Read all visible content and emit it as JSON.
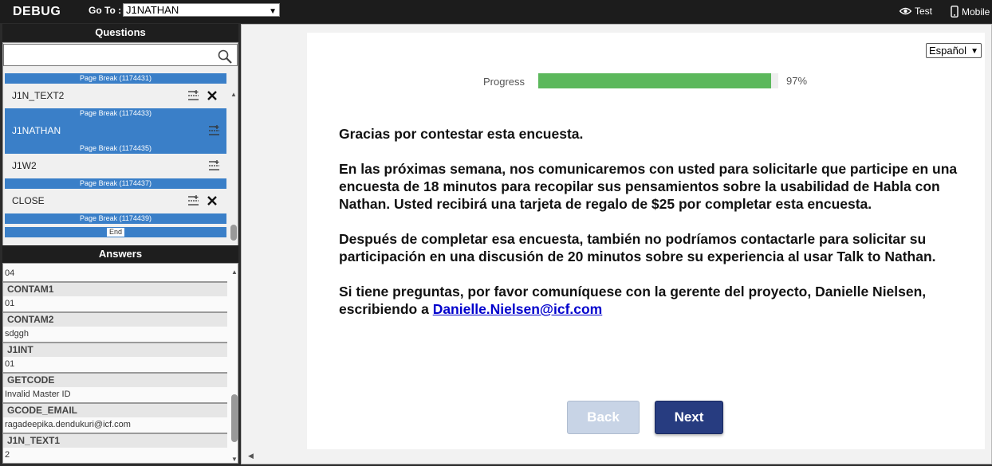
{
  "topbar": {
    "brand": "DEBUG",
    "goto_label": "Go To :",
    "goto_value": "J1NATHAN",
    "test_label": "Test",
    "mobile_label": "Mobile"
  },
  "questions": {
    "header": "Questions",
    "search_value": "",
    "items": [
      {
        "break": "Page Break (1174431)",
        "name": "J1N_TEXT2",
        "selected": false,
        "deletable": true
      },
      {
        "break": "Page Break (1174433)",
        "name": "J1NATHAN",
        "selected": true,
        "deletable": false
      },
      {
        "break": "Page Break (1174435)",
        "name": "J1W2",
        "selected": false,
        "deletable": false
      },
      {
        "break": "Page Break (1174437)",
        "name": "CLOSE",
        "selected": false,
        "deletable": true
      }
    ],
    "last_break": "Page Break (1174439)",
    "end_label": "End"
  },
  "answers": {
    "header": "Answers",
    "first_value": "04",
    "rows": [
      {
        "name": "CONTAM1",
        "value": "01"
      },
      {
        "name": "CONTAM2",
        "value": "sdggh"
      },
      {
        "name": "J1INT",
        "value": "01"
      },
      {
        "name": "GETCODE",
        "value": "Invalid Master ID"
      },
      {
        "name": "GCODE_EMAIL",
        "value": "ragadeepika.dendukuri@icf.com"
      },
      {
        "name": "J1N_TEXT1",
        "value": "2"
      }
    ]
  },
  "survey": {
    "language": "Español",
    "progress_label": "Progress",
    "progress_percent": 97,
    "progress_text": "97%",
    "progress_color": "#5cb85c",
    "paragraph1": "Gracias por contestar esta encuesta.",
    "paragraph2": "En las próximas semana, nos comunicaremos con usted para solicitarle que participe en una encuesta de 18 minutos para recopilar sus pensamientos sobre la usabilidad de Habla con Nathan. Usted recibirá una tarjeta de regalo de $25 por completar esta encuesta.",
    "paragraph3": "Después de completar esa encuesta, también no podríamos contactarle para solicitar su participación en una discusión de 20 minutos sobre su experiencia al usar Talk to Nathan.",
    "paragraph4_text": "Si tiene preguntas, por favor comuníquese con la gerente del proyecto, Danielle Nielsen, escribiendo a ",
    "email_link": "Danielle.Nielsen@icf.com",
    "back_label": "Back",
    "next_label": "Next"
  }
}
